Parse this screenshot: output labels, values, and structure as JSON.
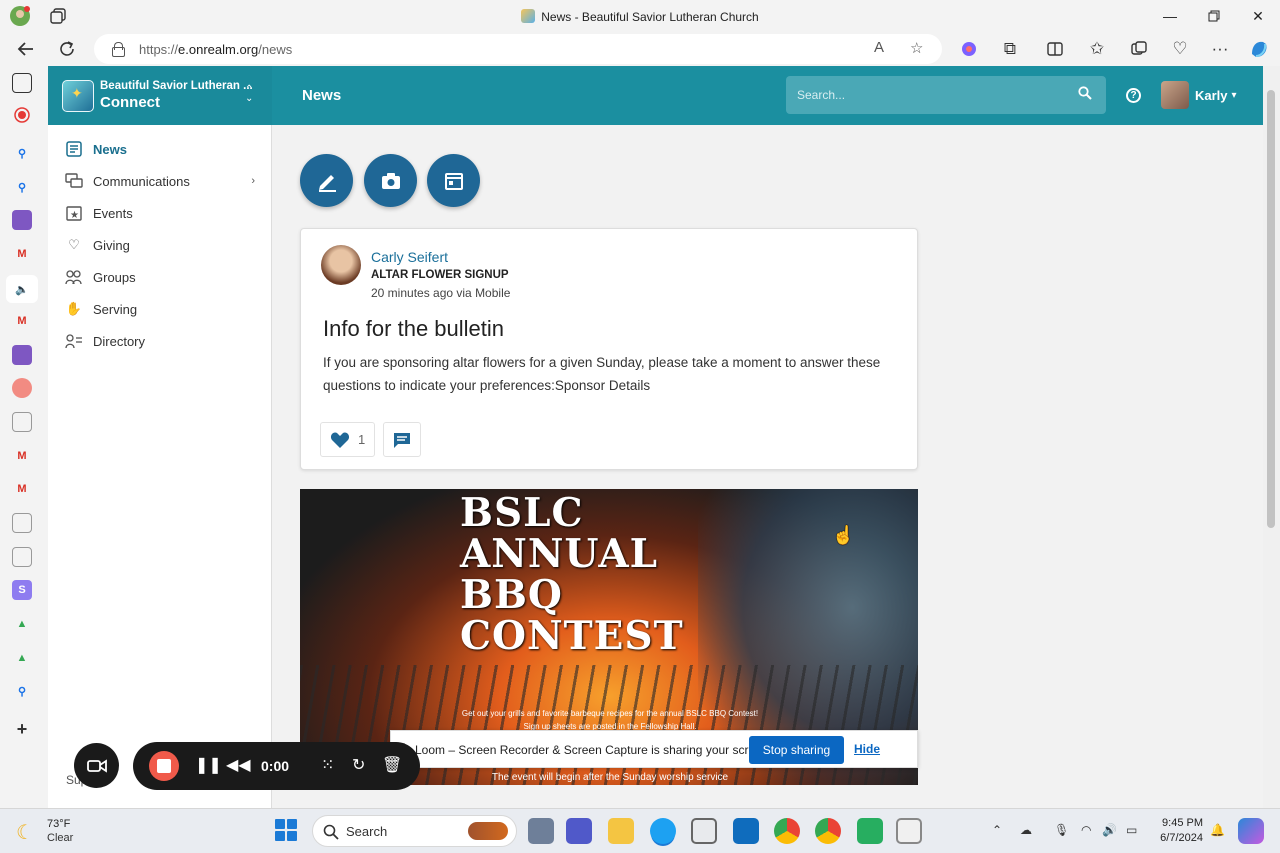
{
  "browser": {
    "tab_title": "News - Beautiful Savior Lutheran Church",
    "url_prefix": "https://",
    "url_host": "e.onrealm.org",
    "url_path": "/news"
  },
  "app": {
    "brand_name": "Beautiful Savior Lutheran ...",
    "brand_sub": "Connect",
    "page_title": "News",
    "search_placeholder": "Search...",
    "user_name": "Karly"
  },
  "nav": {
    "items": [
      {
        "label": "News",
        "icon": "news-icon"
      },
      {
        "label": "Communications",
        "icon": "chat-icon"
      },
      {
        "label": "Events",
        "icon": "calendar-star-icon"
      },
      {
        "label": "Giving",
        "icon": "giving-hand-icon"
      },
      {
        "label": "Groups",
        "icon": "groups-icon"
      },
      {
        "label": "Serving",
        "icon": "hand-icon"
      },
      {
        "label": "Directory",
        "icon": "directory-icon"
      }
    ],
    "support_label": "Support"
  },
  "post": {
    "author": "Carly Seifert",
    "group": "ALTAR FLOWER SIGNUP",
    "time": "20 minutes ago via Mobile",
    "title": "Info for the bulletin",
    "body": "If you are sponsoring altar flowers for a given Sunday, please take a moment to answer these questions to indicate your preferences:Sponsor Details",
    "like_count": "1"
  },
  "promo": {
    "headline_lines": [
      "BSLC",
      "ANNUAL",
      "BBQ",
      "CONTEST"
    ],
    "small_text": "Get out your grills and favorite barbeque recipes for the annual BSLC BBQ Contest! Sign up sheets are posted in the Fellowship Hall.",
    "footer_text": "The event will begin after the Sunday worship service"
  },
  "loom": {
    "notice": "Loom – Screen Recorder & Screen Capture is sharing your screen.",
    "stop_label": "Stop sharing",
    "hide_label": "Hide",
    "timer": "0:00"
  },
  "taskbar": {
    "temperature": "73°F",
    "condition": "Clear",
    "search_label": "Search",
    "time": "9:45 PM",
    "date": "6/7/2024"
  }
}
